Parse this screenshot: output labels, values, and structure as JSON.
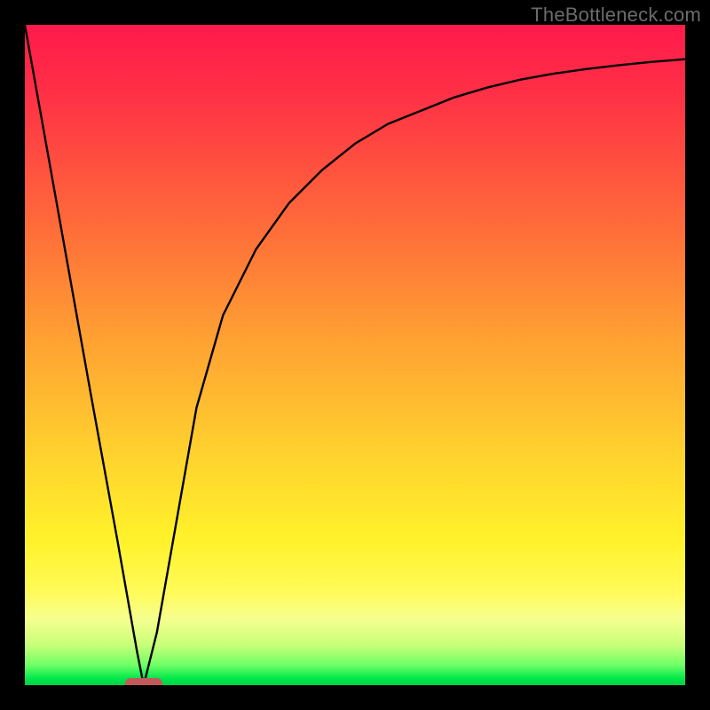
{
  "watermark": {
    "text": "TheBottleneck.com"
  },
  "chart_data": {
    "type": "line",
    "title": "",
    "xlabel": "",
    "ylabel": "",
    "xlim": [
      0,
      100
    ],
    "ylim": [
      0,
      100
    ],
    "grid": false,
    "legend": false,
    "series": [
      {
        "name": "curve",
        "x": [
          0,
          5,
          10,
          14,
          17,
          18,
          20,
          23,
          26,
          30,
          35,
          40,
          45,
          50,
          55,
          60,
          65,
          70,
          75,
          80,
          85,
          90,
          95,
          100
        ],
        "y": [
          100,
          72,
          44,
          22,
          5,
          0,
          8,
          25,
          42,
          56,
          66,
          73,
          78,
          82,
          85,
          87,
          89,
          90.5,
          91.7,
          92.6,
          93.3,
          93.9,
          94.4,
          94.8
        ]
      }
    ],
    "marker": {
      "x": 18,
      "y": 0,
      "shape": "rounded-rect",
      "color": "#c15a58"
    },
    "background_gradient": {
      "direction": "vertical",
      "stops": [
        {
          "pos": 0,
          "color": "#ff1a4b"
        },
        {
          "pos": 50,
          "color": "#ffb330"
        },
        {
          "pos": 80,
          "color": "#fff84c"
        },
        {
          "pos": 100,
          "color": "#00d246"
        }
      ]
    }
  }
}
